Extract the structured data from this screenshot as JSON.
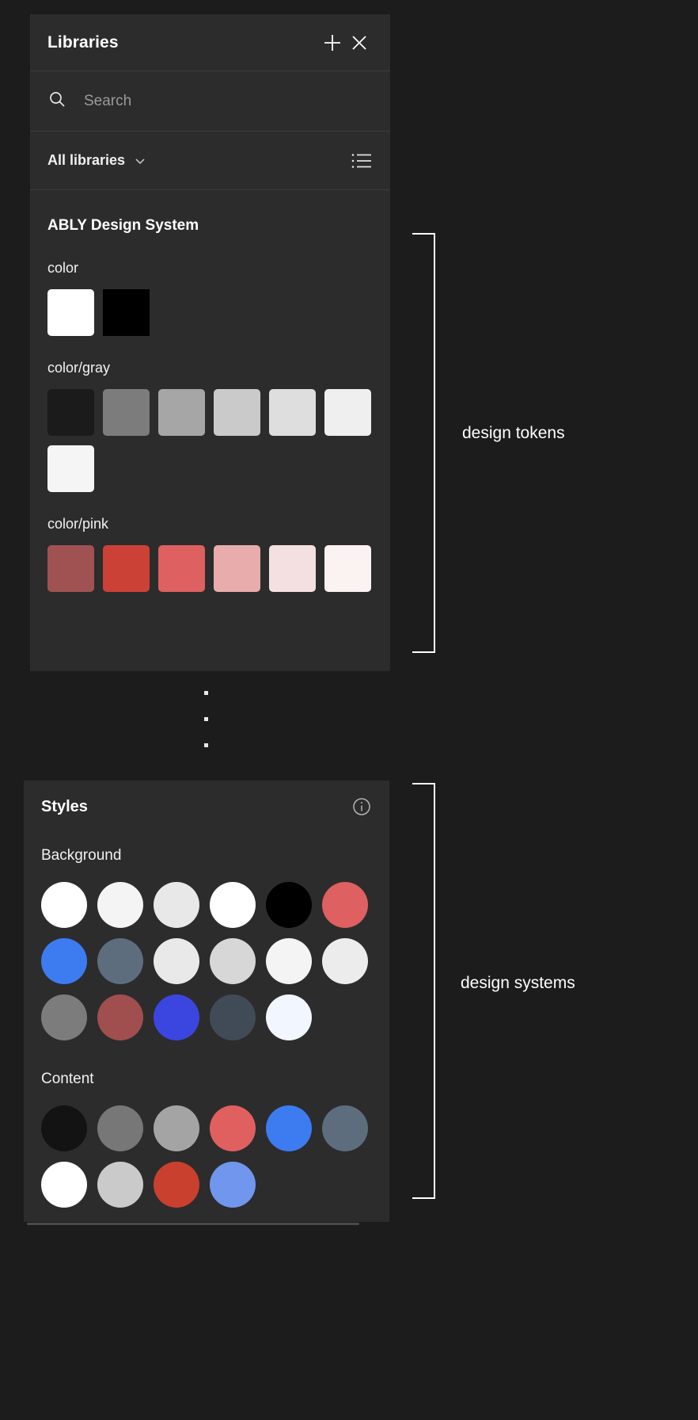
{
  "libraries_panel": {
    "title": "Libraries",
    "add_icon": "plus-icon",
    "close_icon": "close-icon",
    "search": {
      "placeholder": "Search",
      "value": "",
      "icon": "search-icon"
    },
    "filter": {
      "label": "All libraries",
      "chevron_icon": "chevron-down-icon",
      "view_icon": "list-view-icon"
    },
    "library_name": "ABLY Design System",
    "groups": [
      {
        "label": "color",
        "swatches": [
          "#ffffff",
          "#000000"
        ]
      },
      {
        "label": "color/gray",
        "swatches": [
          "#1b1b1b",
          "#7c7c7c",
          "#a6a6a6",
          "#cacaca",
          "#dedede",
          "#efefef",
          "#f5f5f5"
        ]
      },
      {
        "label": "color/pink",
        "swatches": [
          "#a05252",
          "#cc4136",
          "#de6060",
          "#e8acac",
          "#f4e0e0",
          "#fbf2f2"
        ]
      }
    ]
  },
  "ellipsis": {
    "dot_count": 3
  },
  "styles_panel": {
    "title": "Styles",
    "info_icon": "info-icon",
    "groups": [
      {
        "label": "Background",
        "colors": [
          "#ffffff",
          "#f4f4f4",
          "#e8e8e8",
          "#ffffff",
          "#000000",
          "#de6060",
          "#3d7bf0",
          "#5d6d7e",
          "#e9e9e9",
          "#d7d7d7",
          "#f4f4f4",
          "#ececec",
          "#7c7c7c",
          "#a04e4e",
          "#3b46e0",
          "#414b57",
          "#f2f6ff"
        ]
      },
      {
        "label": "Content",
        "colors": [
          "#131313",
          "#777777",
          "#a4a4a4",
          "#e06060",
          "#3d7bf0",
          "#5d6d7e",
          "#ffffff",
          "#cacaca",
          "#c9402f",
          "#7096ee"
        ]
      }
    ]
  },
  "annotations": {
    "design_tokens": "design tokens",
    "design_systems": "design systems",
    "bracket_color": "#ffffff"
  }
}
